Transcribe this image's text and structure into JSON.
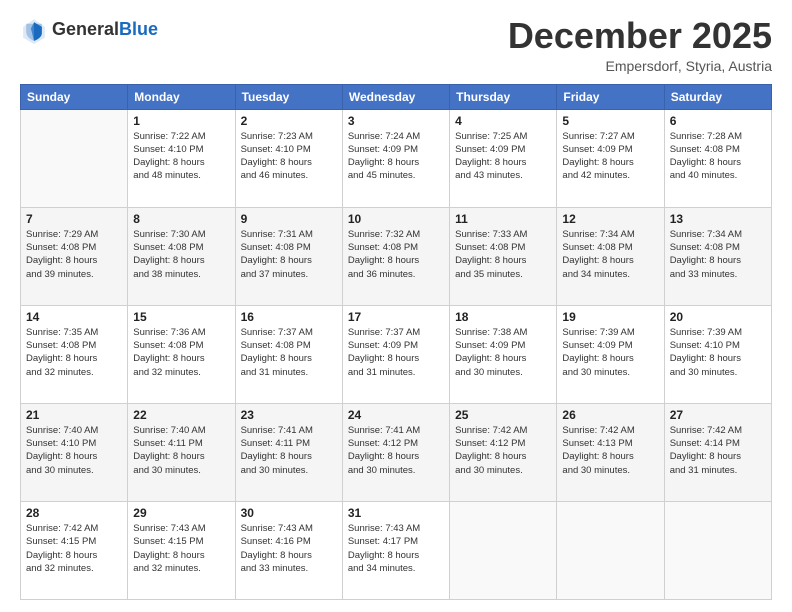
{
  "header": {
    "logo_general": "General",
    "logo_blue": "Blue",
    "month": "December 2025",
    "location": "Empersdorf, Styria, Austria"
  },
  "columns": [
    "Sunday",
    "Monday",
    "Tuesday",
    "Wednesday",
    "Thursday",
    "Friday",
    "Saturday"
  ],
  "weeks": [
    [
      {
        "day": "",
        "info": ""
      },
      {
        "day": "1",
        "info": "Sunrise: 7:22 AM\nSunset: 4:10 PM\nDaylight: 8 hours\nand 48 minutes."
      },
      {
        "day": "2",
        "info": "Sunrise: 7:23 AM\nSunset: 4:10 PM\nDaylight: 8 hours\nand 46 minutes."
      },
      {
        "day": "3",
        "info": "Sunrise: 7:24 AM\nSunset: 4:09 PM\nDaylight: 8 hours\nand 45 minutes."
      },
      {
        "day": "4",
        "info": "Sunrise: 7:25 AM\nSunset: 4:09 PM\nDaylight: 8 hours\nand 43 minutes."
      },
      {
        "day": "5",
        "info": "Sunrise: 7:27 AM\nSunset: 4:09 PM\nDaylight: 8 hours\nand 42 minutes."
      },
      {
        "day": "6",
        "info": "Sunrise: 7:28 AM\nSunset: 4:08 PM\nDaylight: 8 hours\nand 40 minutes."
      }
    ],
    [
      {
        "day": "7",
        "info": "Sunrise: 7:29 AM\nSunset: 4:08 PM\nDaylight: 8 hours\nand 39 minutes."
      },
      {
        "day": "8",
        "info": "Sunrise: 7:30 AM\nSunset: 4:08 PM\nDaylight: 8 hours\nand 38 minutes."
      },
      {
        "day": "9",
        "info": "Sunrise: 7:31 AM\nSunset: 4:08 PM\nDaylight: 8 hours\nand 37 minutes."
      },
      {
        "day": "10",
        "info": "Sunrise: 7:32 AM\nSunset: 4:08 PM\nDaylight: 8 hours\nand 36 minutes."
      },
      {
        "day": "11",
        "info": "Sunrise: 7:33 AM\nSunset: 4:08 PM\nDaylight: 8 hours\nand 35 minutes."
      },
      {
        "day": "12",
        "info": "Sunrise: 7:34 AM\nSunset: 4:08 PM\nDaylight: 8 hours\nand 34 minutes."
      },
      {
        "day": "13",
        "info": "Sunrise: 7:34 AM\nSunset: 4:08 PM\nDaylight: 8 hours\nand 33 minutes."
      }
    ],
    [
      {
        "day": "14",
        "info": "Sunrise: 7:35 AM\nSunset: 4:08 PM\nDaylight: 8 hours\nand 32 minutes."
      },
      {
        "day": "15",
        "info": "Sunrise: 7:36 AM\nSunset: 4:08 PM\nDaylight: 8 hours\nand 32 minutes."
      },
      {
        "day": "16",
        "info": "Sunrise: 7:37 AM\nSunset: 4:08 PM\nDaylight: 8 hours\nand 31 minutes."
      },
      {
        "day": "17",
        "info": "Sunrise: 7:37 AM\nSunset: 4:09 PM\nDaylight: 8 hours\nand 31 minutes."
      },
      {
        "day": "18",
        "info": "Sunrise: 7:38 AM\nSunset: 4:09 PM\nDaylight: 8 hours\nand 30 minutes."
      },
      {
        "day": "19",
        "info": "Sunrise: 7:39 AM\nSunset: 4:09 PM\nDaylight: 8 hours\nand 30 minutes."
      },
      {
        "day": "20",
        "info": "Sunrise: 7:39 AM\nSunset: 4:10 PM\nDaylight: 8 hours\nand 30 minutes."
      }
    ],
    [
      {
        "day": "21",
        "info": "Sunrise: 7:40 AM\nSunset: 4:10 PM\nDaylight: 8 hours\nand 30 minutes."
      },
      {
        "day": "22",
        "info": "Sunrise: 7:40 AM\nSunset: 4:11 PM\nDaylight: 8 hours\nand 30 minutes."
      },
      {
        "day": "23",
        "info": "Sunrise: 7:41 AM\nSunset: 4:11 PM\nDaylight: 8 hours\nand 30 minutes."
      },
      {
        "day": "24",
        "info": "Sunrise: 7:41 AM\nSunset: 4:12 PM\nDaylight: 8 hours\nand 30 minutes."
      },
      {
        "day": "25",
        "info": "Sunrise: 7:42 AM\nSunset: 4:12 PM\nDaylight: 8 hours\nand 30 minutes."
      },
      {
        "day": "26",
        "info": "Sunrise: 7:42 AM\nSunset: 4:13 PM\nDaylight: 8 hours\nand 30 minutes."
      },
      {
        "day": "27",
        "info": "Sunrise: 7:42 AM\nSunset: 4:14 PM\nDaylight: 8 hours\nand 31 minutes."
      }
    ],
    [
      {
        "day": "28",
        "info": "Sunrise: 7:42 AM\nSunset: 4:15 PM\nDaylight: 8 hours\nand 32 minutes."
      },
      {
        "day": "29",
        "info": "Sunrise: 7:43 AM\nSunset: 4:15 PM\nDaylight: 8 hours\nand 32 minutes."
      },
      {
        "day": "30",
        "info": "Sunrise: 7:43 AM\nSunset: 4:16 PM\nDaylight: 8 hours\nand 33 minutes."
      },
      {
        "day": "31",
        "info": "Sunrise: 7:43 AM\nSunset: 4:17 PM\nDaylight: 8 hours\nand 34 minutes."
      },
      {
        "day": "",
        "info": ""
      },
      {
        "day": "",
        "info": ""
      },
      {
        "day": "",
        "info": ""
      }
    ]
  ]
}
